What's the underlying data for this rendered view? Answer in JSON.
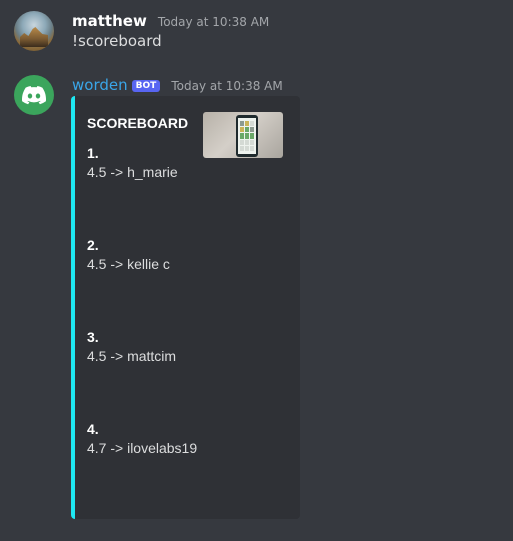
{
  "messages": [
    {
      "username": "matthew",
      "timestamp": "Today at 10:38 AM",
      "content": "!scoreboard"
    },
    {
      "username": "worden",
      "bot_tag": "BOT",
      "timestamp": "Today at 10:38 AM",
      "embed": {
        "accent_color": "#1ee8f2",
        "title": "SCOREBOARD",
        "entries": [
          {
            "rank": "1.",
            "value": "4.5 -> h_marie"
          },
          {
            "rank": "2.",
            "value": "4.5 -> kellie c"
          },
          {
            "rank": "3.",
            "value": "4.5 -> mattcim"
          },
          {
            "rank": "4.",
            "value": "4.7 -> ilovelabs19"
          }
        ]
      }
    }
  ],
  "colors": {
    "background": "#36393f",
    "embed_background": "#2f3136",
    "bot_tag": "#5865f2",
    "worden_name": "#3aa6e8",
    "discord_avatar": "#3ba55c"
  }
}
